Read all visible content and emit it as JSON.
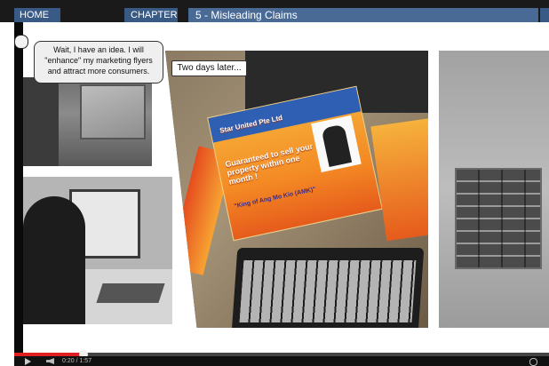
{
  "nav": {
    "home": "HOME",
    "chapter": "CHAPTER",
    "chapter_title": "5 - Misleading Claims"
  },
  "scene": {
    "speech": "Wait, I have an idea. I will \"enhance\" my marketing flyers and attract more consumers.",
    "caption": "Two days later...",
    "flyer": {
      "company": "Star United Pte Ltd",
      "headline": "Guaranteed to sell your property within one month !",
      "tagline": "\"King of Ang Mo Kio (AMK)\""
    }
  },
  "player": {
    "played_fraction": 0.13,
    "time": "0:20 / 1:57"
  },
  "colors": {
    "nav_tab": "#3a5a86",
    "progress_played": "#e02020"
  },
  "icons": {
    "play": "play-icon",
    "volume": "volume-icon",
    "settings": "settings-icon"
  }
}
